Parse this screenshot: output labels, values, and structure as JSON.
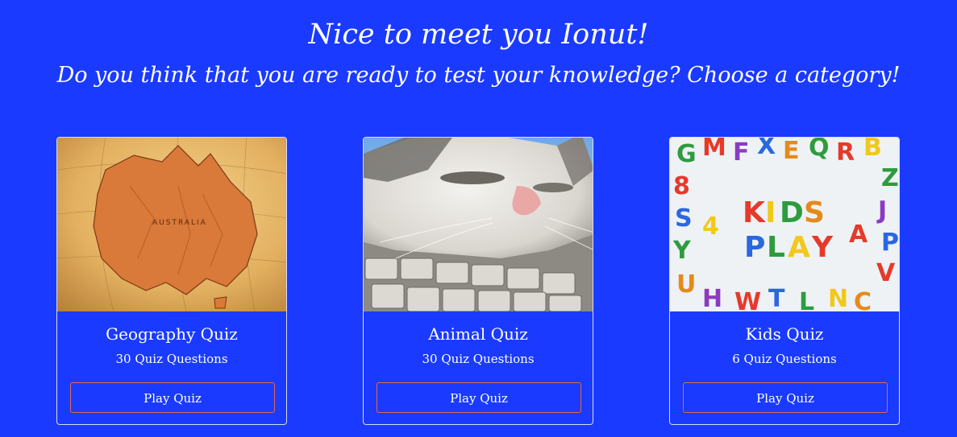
{
  "header": {
    "title": "Nice to meet you Ionut!",
    "subtitle": "Do you think that you are ready to test your knowledge? Choose a category!"
  },
  "colors": {
    "background": "#1a3aff",
    "button_border": "#e06a4a"
  },
  "cards": [
    {
      "title": "Geography Quiz",
      "subtitle": "30 Quiz Questions",
      "button_label": "Play Quiz",
      "image": "australia-globe-image"
    },
    {
      "title": "Animal Quiz",
      "subtitle": "30 Quiz Questions",
      "button_label": "Play Quiz",
      "image": "cat-on-keyboard-image"
    },
    {
      "title": "Kids Quiz",
      "subtitle": "6 Quiz Questions",
      "button_label": "Play Quiz",
      "image": "kids-play-magnet-letters-image"
    }
  ]
}
